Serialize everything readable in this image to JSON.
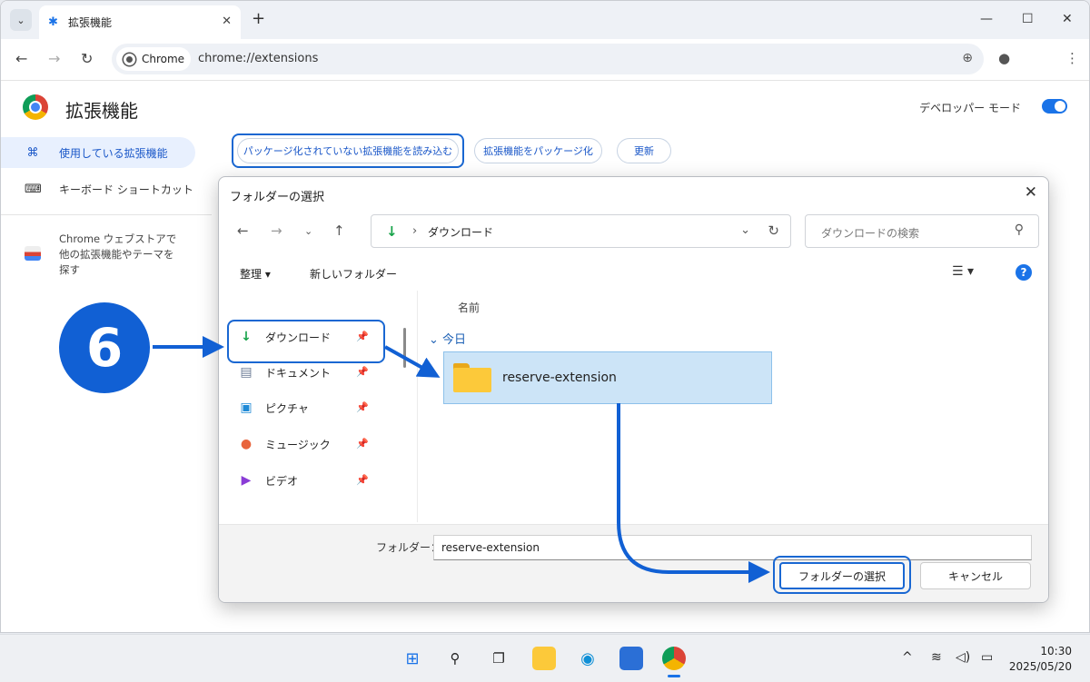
{
  "browser": {
    "tab_title": "拡張機能",
    "chip_label": "Chrome",
    "url": "chrome://extensions"
  },
  "extensions_page": {
    "title": "拡張機能",
    "developer_mode_label": "デベロッパー モード",
    "developer_mode_on": true,
    "sidebar": {
      "items": [
        {
          "label": "使用している拡張機能",
          "icon": "puzzle-icon",
          "active": true
        },
        {
          "label": "キーボード ショートカット",
          "icon": "keyboard-icon",
          "active": false
        }
      ],
      "webstore_text": "Chrome ウェブストアで他の拡張機能やテーマを探す"
    },
    "buttons": {
      "load_unpacked": "パッケージ化されていない拡張機能を読み込む",
      "pack_extension": "拡張機能をパッケージ化",
      "update": "更新"
    }
  },
  "dialog": {
    "title": "フォルダーの選択",
    "address_path": "ダウンロード",
    "search_placeholder": "ダウンロードの検索",
    "commands": {
      "organize": "整理",
      "new_folder": "新しいフォルダー"
    },
    "nav_items": [
      {
        "label": "ダウンロード",
        "icon": "download-icon"
      },
      {
        "label": "ドキュメント",
        "icon": "document-icon"
      },
      {
        "label": "ピクチャ",
        "icon": "pictures-icon"
      },
      {
        "label": "ミュージック",
        "icon": "music-icon"
      },
      {
        "label": "ビデオ",
        "icon": "video-icon"
      }
    ],
    "column_header": "名前",
    "group_label": "今日",
    "files": [
      {
        "name": "reserve-extension",
        "icon": "folder-icon",
        "selected": true
      }
    ],
    "folder_label": "フォルダー：",
    "folder_value": "reserve-extension",
    "select_button": "フォルダーの選択",
    "cancel_button": "キャンセル"
  },
  "annotation": {
    "step_number": "6",
    "accent_color": "#1160d4"
  },
  "taskbar": {
    "time": "10:30",
    "date": "2025/05/20"
  }
}
